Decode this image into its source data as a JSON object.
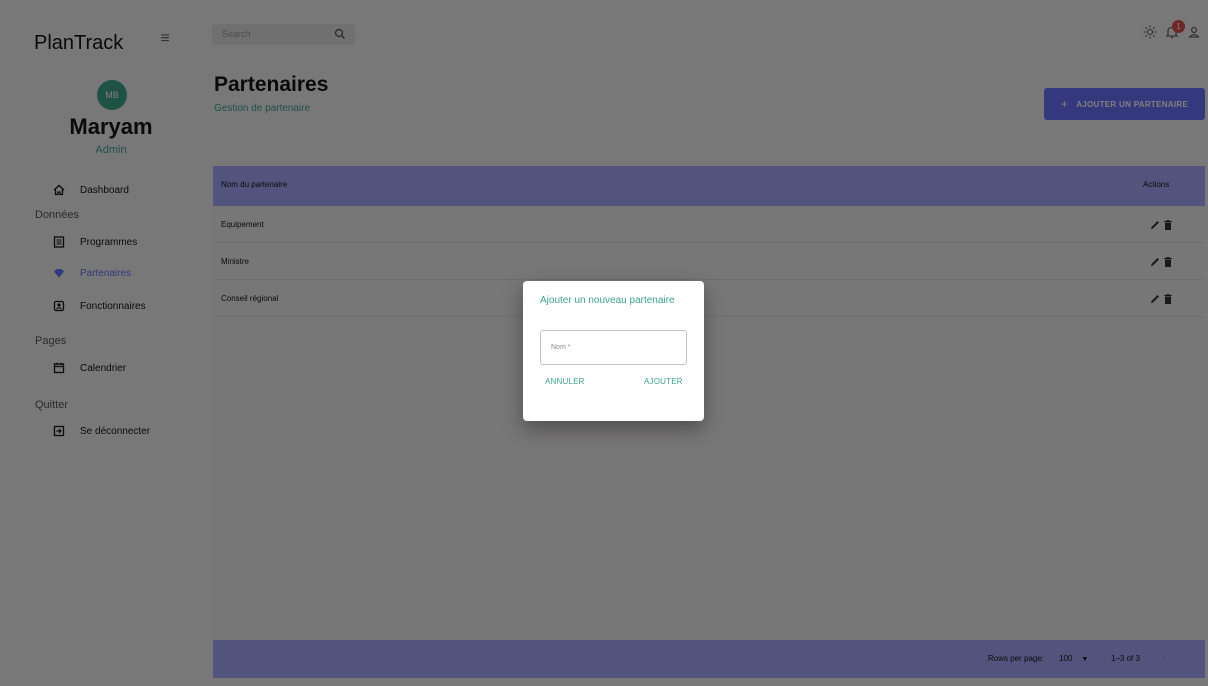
{
  "app": {
    "brand": "PlanTrack"
  },
  "user": {
    "initials": "MB",
    "name": "Maryam",
    "role": "Admin"
  },
  "sidebar": {
    "dashboard": "Dashboard",
    "section_data": "Données",
    "items_data": [
      "Programmes",
      "Partenaires",
      "Fonctionnaires"
    ],
    "section_pages": "Pages",
    "items_pages": [
      "Calendrier"
    ],
    "section_quit": "Quitter",
    "items_quit": [
      "Se déconnecter"
    ],
    "active_item": "Partenaires"
  },
  "topbar": {
    "search_placeholder": "Search",
    "notification_count": "1"
  },
  "header": {
    "title": "Partenaires",
    "subtitle": "Gestion de partenaire",
    "add_button": "AJOUTER UN PARTENAIRE"
  },
  "grid": {
    "columns": [
      "Nom du partenaire",
      "Actions"
    ],
    "rows": [
      {
        "name": "Equipement"
      },
      {
        "name": "Ministre"
      },
      {
        "name": "Conseil régional"
      }
    ],
    "footer": {
      "rows_per_page_label": "Rows per page:",
      "rows_per_page_value": "100",
      "range": "1–3 of 3"
    }
  },
  "dialog": {
    "title": "Ajouter un nouveau partenaire",
    "field_label": "Nom *",
    "cancel": "ANNULER",
    "confirm": "AJOUTER"
  },
  "colors": {
    "accent": "#6870fa",
    "green": "#3da58a",
    "header_bg": "#a4a9fc"
  }
}
